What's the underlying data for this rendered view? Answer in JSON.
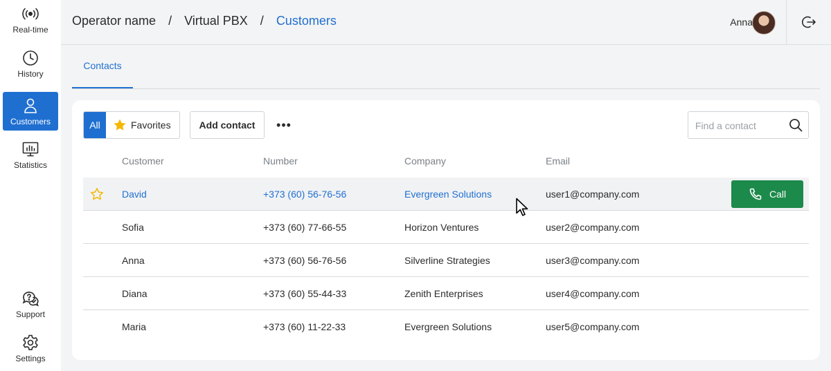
{
  "sidebar": {
    "items": [
      {
        "label": "Real-time",
        "icon": "broadcast-icon"
      },
      {
        "label": "History",
        "icon": "clock-icon"
      },
      {
        "label": "Customers",
        "icon": "person-icon",
        "active": true
      },
      {
        "label": "Statistics",
        "icon": "chart-monitor-icon"
      },
      {
        "label": "Support",
        "icon": "support-chat-icon"
      },
      {
        "label": "Settings",
        "icon": "gear-icon"
      }
    ]
  },
  "header": {
    "breadcrumb": [
      "Operator name",
      "Virtual PBX",
      "Customers"
    ],
    "separator": "/",
    "user_name": "Anna"
  },
  "tabs": [
    {
      "label": "Contacts",
      "active": true
    }
  ],
  "toolbar": {
    "filter_all": "All",
    "filter_favorites": "Favorites",
    "add_contact": "Add contact",
    "more": "•••",
    "search_placeholder": "Find a contact"
  },
  "table": {
    "columns": [
      "Customer",
      "Number",
      "Company",
      "Email"
    ],
    "rows": [
      {
        "customer": "David",
        "number": "+373 (60) 56-76-56",
        "company": "Evergreen Solutions",
        "email": "user1@company.com",
        "hovered": true
      },
      {
        "customer": "Sofia",
        "number": "+373 (60) 77-66-55",
        "company": "Horizon Ventures",
        "email": "user2@company.com"
      },
      {
        "customer": "Anna",
        "number": "+373 (60) 56-76-56",
        "company": "Silverline Strategies",
        "email": "user3@company.com"
      },
      {
        "customer": "Diana",
        "number": "+373 (60) 55-44-33",
        "company": "Zenith Enterprises",
        "email": "user4@company.com"
      },
      {
        "customer": "Maria",
        "number": "+373 (60) 11-22-33",
        "company": "Evergreen Solutions",
        "email": "user5@company.com"
      }
    ],
    "call_label": "Call"
  },
  "colors": {
    "accent": "#1f6fd1",
    "call_green": "#1c8a4a",
    "star_yellow": "#f5b800"
  }
}
